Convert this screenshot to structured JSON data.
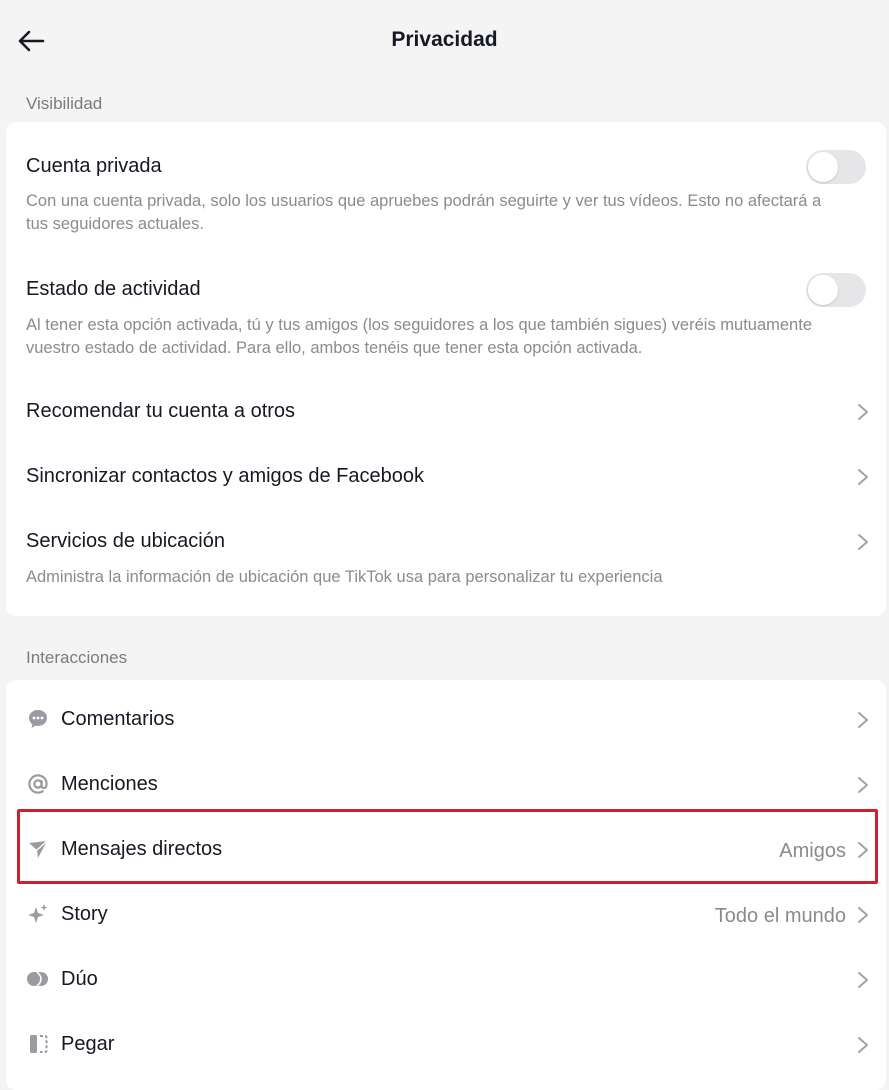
{
  "header": {
    "title": "Privacidad",
    "back_icon": "arrow-left-icon"
  },
  "visibility": {
    "label": "Visibilidad",
    "private_account": {
      "title": "Cuenta privada",
      "description": "Con una cuenta privada, solo los usuarios que apruebes podrán seguirte y ver tus vídeos. Esto no afectará a tus seguidores actuales.",
      "enabled": false
    },
    "activity_status": {
      "title": "Estado de actividad",
      "description": "Al tener esta opción activada, tú y tus amigos (los seguidores a los que también sigues) veréis mutuamente vuestro estado de actividad. Para ello, ambos tenéis que tener esta opción activada.",
      "enabled": false
    },
    "suggest_account": {
      "title": "Recomendar tu cuenta a otros"
    },
    "sync_contacts": {
      "title": "Sincronizar contactos y amigos de Facebook"
    },
    "location": {
      "title": "Servicios de ubicación",
      "description": "Administra la información de ubicación que TikTok usa para personalizar tu experiencia"
    }
  },
  "interactions": {
    "label": "Interacciones",
    "items": [
      {
        "title": "Comentarios",
        "value": "",
        "icon": "comment-bubble-icon"
      },
      {
        "title": "Menciones",
        "value": "",
        "icon": "at-sign-icon"
      },
      {
        "title": "Mensajes directos",
        "value": "Amigos",
        "icon": "paper-plane-icon"
      },
      {
        "title": "Story",
        "value": "Todo el mundo",
        "icon": "sparkle-icon"
      },
      {
        "title": "Dúo",
        "value": "",
        "icon": "duet-icon"
      },
      {
        "title": "Pegar",
        "value": "",
        "icon": "stitch-icon"
      }
    ]
  },
  "colors": {
    "background": "#f4f4f4",
    "card": "#ffffff",
    "text_primary": "#161823",
    "text_secondary": "#8a8b91",
    "toggle_off": "#e6e6e8",
    "highlight": "#d0202e"
  }
}
